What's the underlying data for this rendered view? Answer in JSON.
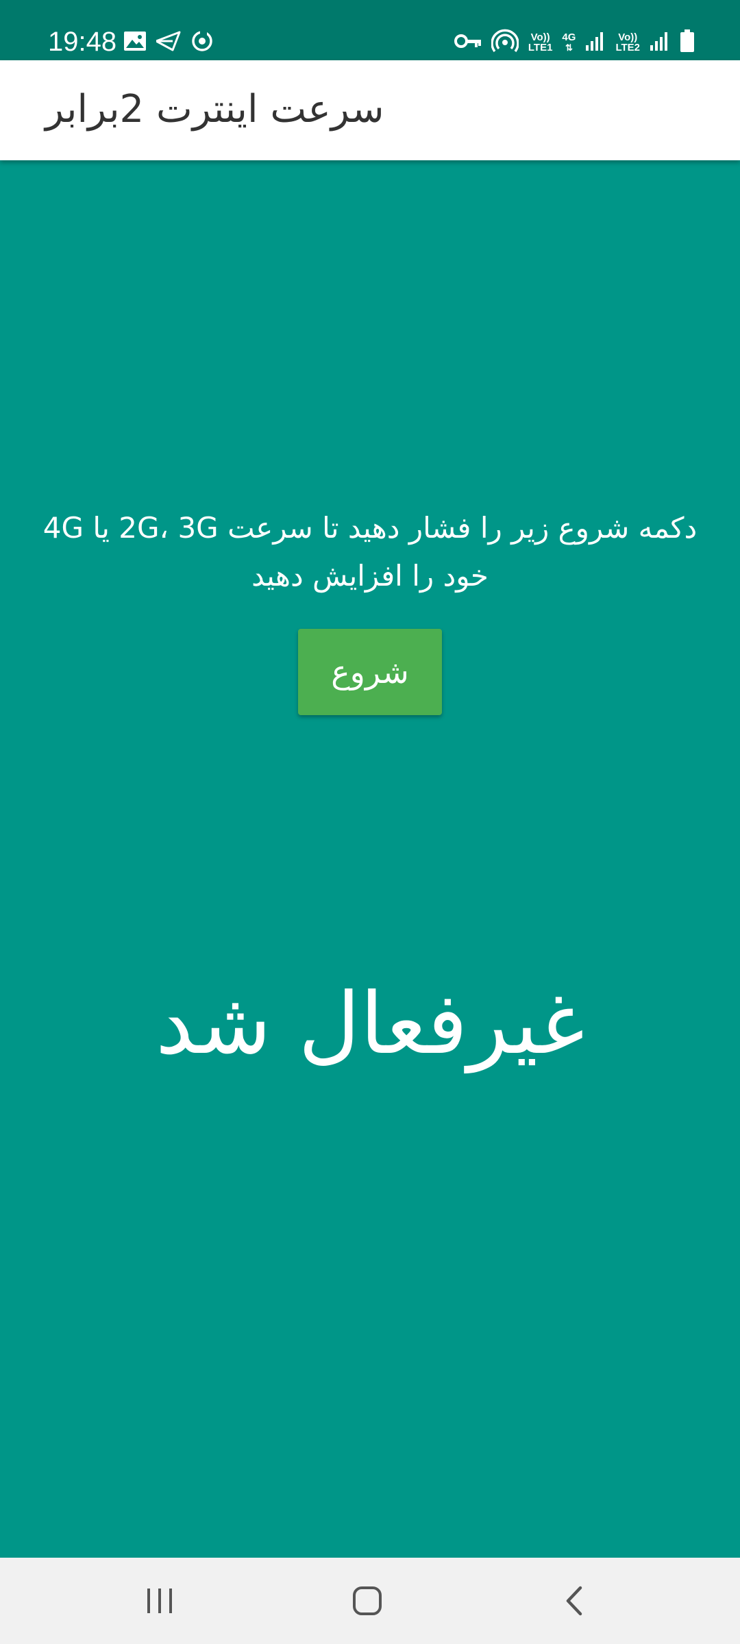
{
  "status_bar": {
    "time": "19:48",
    "left_icons": [
      "image-icon",
      "send-icon",
      "sync-icon"
    ],
    "right_icons": [
      "vpn-key-icon",
      "hotspot-icon",
      "volte-sim1-icon",
      "4g-data-icon",
      "signal-sim1-icon",
      "volte-sim2-icon",
      "signal-sim2-icon",
      "battery-icon"
    ],
    "sim1_volte_line1": "Vo))",
    "sim1_volte_line2": "LTE1",
    "data_type": "4G",
    "sim2_volte_line1": "Vo))",
    "sim2_volte_line2": "LTE2",
    "color": "#00796b"
  },
  "app_bar": {
    "title": "سرعت اینترت 2برابر"
  },
  "main": {
    "instruction": "دکمه شروع زیر را فشار دهید تا سرعت 2G، 3G یا 4G خود را افزایش دهید",
    "start_button_label": "شروع",
    "status_message": "غیرفعال شد",
    "background_color": "#009688",
    "button_color": "#4caf50"
  },
  "nav_bar": {
    "buttons": [
      "recent-apps-icon",
      "home-icon",
      "back-icon"
    ]
  }
}
